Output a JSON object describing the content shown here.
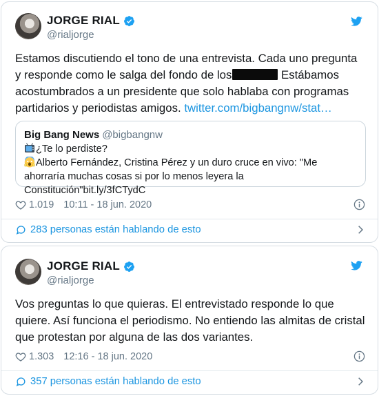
{
  "tweets": [
    {
      "author": {
        "name": "JORGE RIAL",
        "handle": "@rialjorge"
      },
      "text_part1": "Estamos discutiendo el tono de una entrevista. Cada uno pregunta y responde como le salga del fondo de los",
      "text_part2": " Estábamos acostumbrados a un presidente que solo hablaba con programas partidarios y periodistas amigos. ",
      "link": "twitter.com/bigbangnw/stat…",
      "quote": {
        "name": "Big Bang News",
        "handle": "@bigbangnw",
        "line1": "¿Te lo perdiste?",
        "line2": "Alberto Fernández, Cristina Pérez y un duro cruce en vivo: \"Me ahorraría muchas cosas si por lo menos leyera la Constitución\"bit.ly/3fCTydC"
      },
      "likes": "1.019",
      "timestamp": "10:11 - 18 jun. 2020",
      "conversation": "283 personas están hablando de esto"
    },
    {
      "author": {
        "name": "JORGE RIAL",
        "handle": "@rialjorge"
      },
      "text": "Vos preguntas lo que quieras. El entrevistado responde lo que quiere. Así funciona el periodismo. No entiendo las almitas de cristal que protestan por alguna de las dos variantes.",
      "likes": "1.303",
      "timestamp": "12:16 - 18 jun. 2020",
      "conversation": "357 personas están hablando de esto"
    }
  ],
  "icons": {
    "verified": "verified-badge-icon",
    "bird": "twitter-bird-icon",
    "heart": "heart-icon",
    "info": "info-icon",
    "bubble": "speech-bubble-icon",
    "chevron": "chevron-right-icon",
    "tv": "television-emoji",
    "scream": "face-screaming-emoji"
  },
  "colors": {
    "accent": "#1b95e0",
    "muted": "#657786",
    "text": "#14171a",
    "border": "#d6dde3"
  }
}
